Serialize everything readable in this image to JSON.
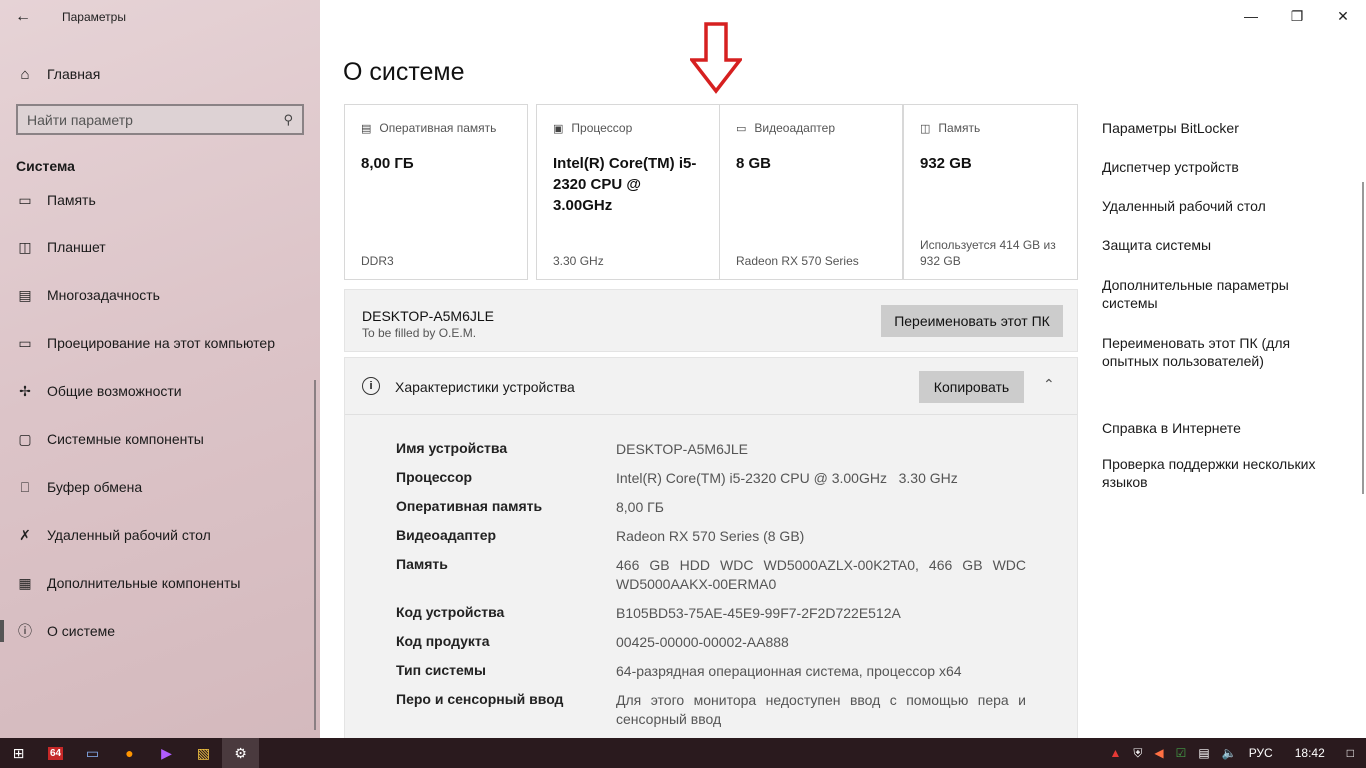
{
  "window": {
    "title": "Параметры"
  },
  "sidebar": {
    "home_label": "Главная",
    "search_placeholder": "Найти параметр",
    "section_title": "Система",
    "items": [
      {
        "label": "Память",
        "icon": "storage-icon"
      },
      {
        "label": "Планшет",
        "icon": "tablet-icon"
      },
      {
        "label": "Многозадачность",
        "icon": "multitasking-icon"
      },
      {
        "label": "Проецирование на этот компьютер",
        "icon": "project-icon"
      },
      {
        "label": "Общие возможности",
        "icon": "shared-experiences-icon"
      },
      {
        "label": "Системные компоненты",
        "icon": "system-components-icon"
      },
      {
        "label": "Буфер обмена",
        "icon": "clipboard-icon"
      },
      {
        "label": "Удаленный рабочий стол",
        "icon": "remote-desktop-icon"
      },
      {
        "label": "Дополнительные компоненты",
        "icon": "optional-features-icon"
      },
      {
        "label": "О системе",
        "icon": "info-icon",
        "active": true
      }
    ]
  },
  "main": {
    "title": "О системе",
    "cards": [
      {
        "label": "Оперативная память",
        "value": "8,00 ГБ",
        "sub": "DDR3",
        "icon": "ram-icon"
      },
      {
        "label": "Процессор",
        "value": "Intel(R) Core(TM) i5-2320 CPU @ 3.00GHz",
        "sub": "3.30 GHz",
        "icon": "cpu-icon"
      },
      {
        "label": "Видеоадаптер",
        "value": "8 GB",
        "sub": "Radeon RX 570 Series",
        "icon": "gpu-icon"
      },
      {
        "label": "Память",
        "value": "932 GB",
        "sub": "Используется 414 GB из 932 GB",
        "icon": "disk-icon"
      }
    ],
    "pc": {
      "name": "DESKTOP-A5M6JLE",
      "oem": "To be filled by O.E.M.",
      "rename_label": "Переименовать этот ПК"
    },
    "specs": {
      "title": "Характеристики устройства",
      "copy_label": "Копировать",
      "rows": [
        {
          "k": "Имя устройства",
          "v": "DESKTOP-A5M6JLE"
        },
        {
          "k": "Процессор",
          "v": "Intel(R) Core(TM) i5-2320 CPU @ 3.00GHz   3.30 GHz"
        },
        {
          "k": "Оперативная память",
          "v": "8,00 ГБ"
        },
        {
          "k": "Видеоадаптер",
          "v": "Radeon RX 570 Series (8 GB)"
        },
        {
          "k": "Память",
          "v": "466 GB HDD WDC WD5000AZLX-00K2TA0, 466 GB WDC WD5000AAKX-00ERMA0"
        },
        {
          "k": "Код устройства",
          "v": "B105BD53-75AE-45E9-99F7-2F2D722E512A"
        },
        {
          "k": "Код продукта",
          "v": "00425-00000-00002-AA888"
        },
        {
          "k": "Тип системы",
          "v": "64-разрядная операционная система, процессор x64"
        },
        {
          "k": "Перо и сенсорный ввод",
          "v": "Для этого монитора недоступен ввод с помощью пера и сенсорный ввод"
        }
      ]
    }
  },
  "related": {
    "links": [
      "Параметры BitLocker",
      "Диспетчер устройств",
      "Удаленный рабочий стол",
      "Защита системы",
      "Дополнительные параметры системы",
      "Переименовать этот ПК (для опытных пользователей)"
    ],
    "help_title": "Справка в Интернете",
    "help_links": [
      "Проверка поддержки нескольких языков"
    ]
  },
  "taskbar": {
    "lang": "РУС",
    "time": "18:42",
    "badge": "64"
  },
  "colors": {
    "arrow": "#d62020",
    "taskbar": "#2a1a1e",
    "sidebar": "#dcc4c8"
  }
}
